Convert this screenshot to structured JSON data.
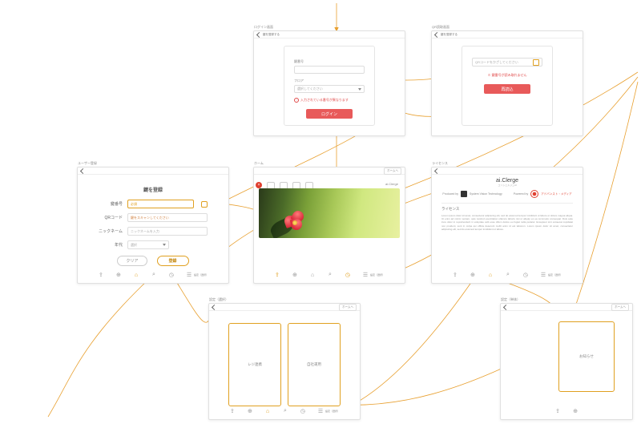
{
  "diagram_type": "app-flow-wireframe",
  "app": {
    "name": "ai.Clerge",
    "tagline": "コンシェルジュAI"
  },
  "frames": {
    "login": {
      "title": "ログイン画面",
      "breadcrumb": "鍵を登録する",
      "field_key_label": "鍵番号",
      "field_floor_label": "フロア",
      "field_floor_value": "選択してください",
      "error": "入力されている番号が異なります",
      "submit": "ログイン"
    },
    "qr": {
      "title": "QR読取画面",
      "breadcrumb": "鍵を登録する",
      "hint": "QRコードをかざしてください",
      "error": "※ 鍵番号が読み取れません",
      "submit": "再読込"
    },
    "register": {
      "title": "ユーザー登録",
      "heading": "鍵を登録",
      "rows": {
        "key": {
          "label": "鍵番号",
          "badge": "必須"
        },
        "qr": {
          "label": "QRコード",
          "placeholder": "鍵をスキャンしてください"
        },
        "nick": {
          "label": "ニックネーム",
          "placeholder": "ニックネームを入力"
        },
        "age": {
          "label": "年代",
          "value": "選択"
        }
      },
      "clear": "クリア",
      "submit": "登録"
    },
    "home": {
      "title": "ホーム",
      "logo": "ai.Clerge"
    },
    "license": {
      "title": "ライセンス",
      "produced_label": "Produced by",
      "produced_name": "System Vision Technology",
      "powered_label": "Powered by",
      "powered_name": "アドバンスト・メディア",
      "section": "ライセンス",
      "body": "Lorem ipsum dolor sit amet, consectetur adipiscing elit, sed do eiusmod tempor incididunt ut labore et dolore magna aliqua. Ut enim ad minim veniam, quis nostrud exercitation ullamco laboris nisi ut aliquip ex ea commodo consequat. Duis aute irure dolor in reprehenderit in voluptate velit esse cillum dolore eu fugiat nulla pariatur. Excepteur sint occaecat cupidatat non proident, sunt in culpa qui officia deserunt mollit anim id est laborum. Lorem ipsum dolor sit amet, consectetur adipiscing elit, sed do eiusmod tempor incididunt ut labore."
    },
    "settings_two": {
      "title": "設定（選択）",
      "left": "レジ連携",
      "right": "自社運用"
    },
    "settings_one": {
      "title": "設定（単体）",
      "label": "お知らせ"
    }
  },
  "tabs": [
    "share-icon",
    "add-icon",
    "home-icon",
    "search-icon",
    "history-icon",
    "settings-label"
  ],
  "topbtn": "ホームへ"
}
